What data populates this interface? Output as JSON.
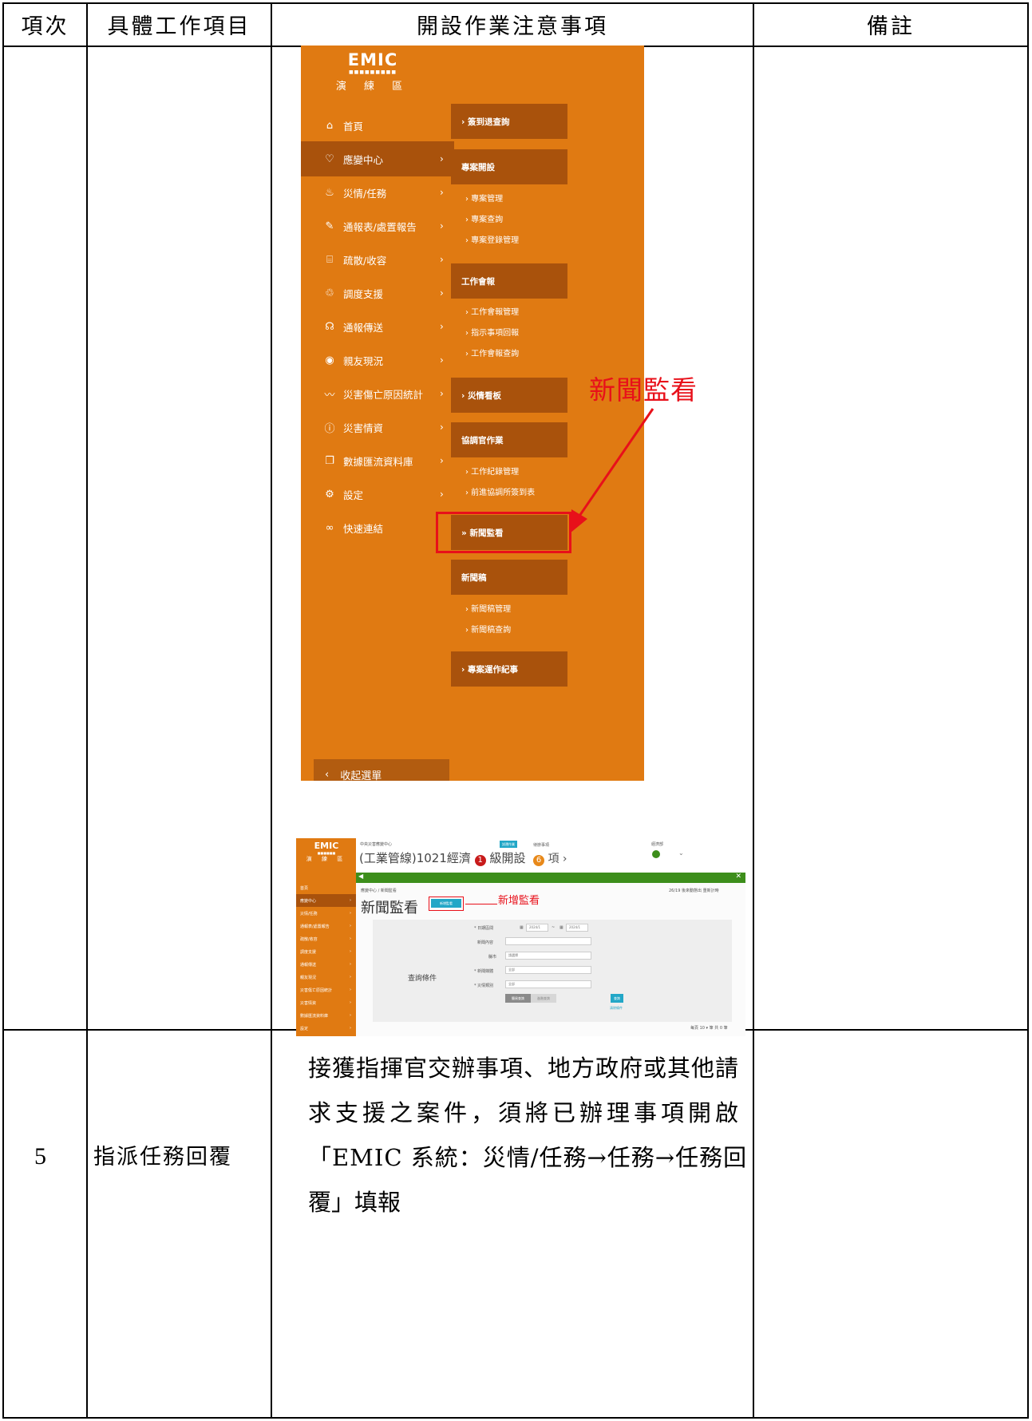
{
  "table": {
    "headers": [
      "項次",
      "具體工作項目",
      "開設作業注意事項",
      "備註"
    ],
    "row5": {
      "number": "5",
      "item": "指派任務回覆",
      "note_lines": [
        "接獲指揮官交辦事項、地方政府或其他請",
        "求支援之案件，須將已辦理事項開啟",
        "「EMIC 系統：災情/任務→任務→任務回",
        "覆」填報"
      ]
    }
  },
  "screenshot1": {
    "logo": {
      "brand": "EMIC",
      "tiny": "■■■■■■■■■",
      "sub": "演 練 區"
    },
    "menu": [
      {
        "icon": "home-icon",
        "glyph": "⌂",
        "label": "首頁",
        "chevron": ""
      },
      {
        "icon": "shield-icon",
        "glyph": "♡",
        "label": "應變中心",
        "chevron": "›",
        "active": true
      },
      {
        "icon": "disaster-icon",
        "glyph": "♨",
        "label": "災情/任務",
        "chevron": "›"
      },
      {
        "icon": "edit-icon",
        "glyph": "✎",
        "label": "通報表/處置報告",
        "chevron": "›"
      },
      {
        "icon": "shelter-icon",
        "glyph": "⌸",
        "label": "疏散/收容",
        "chevron": "›"
      },
      {
        "icon": "support-icon",
        "glyph": "♲",
        "label": "調度支援",
        "chevron": "›"
      },
      {
        "icon": "transmit-icon",
        "glyph": "☊",
        "label": "通報傳送",
        "chevron": "›"
      },
      {
        "icon": "eye-icon",
        "glyph": "◉",
        "label": "親友現況",
        "chevron": "›"
      },
      {
        "icon": "trend-icon",
        "glyph": "〰",
        "label": "災害傷亡原因統計",
        "chevron": "›"
      },
      {
        "icon": "info-icon",
        "glyph": "ⓘ",
        "label": "災害情資",
        "chevron": "›"
      },
      {
        "icon": "database-icon",
        "glyph": "❐",
        "label": "數據匯流資料庫",
        "chevron": "›"
      },
      {
        "icon": "gear-icon",
        "glyph": "⚙",
        "label": "設定",
        "chevron": "›"
      },
      {
        "icon": "link-icon",
        "glyph": "∞",
        "label": "快速連結",
        "chevron": ""
      }
    ],
    "collapse_label": "收起選單",
    "submenu": {
      "checkin": "› 簽到退查詢",
      "project_settings": "專案開設",
      "project_links": [
        "› 專案管理",
        "› 專案查詢",
        "› 專案登錄管理"
      ],
      "meeting": "工作會報",
      "meeting_links": [
        "› 工作會報管理",
        "› 指示事項回報",
        "› 工作會報查詢"
      ],
      "board": "› 災情看板",
      "coordinator": "協調官作業",
      "coordinator_links": [
        "› 工作紀錄管理",
        "› 前進協調所簽到表"
      ],
      "news_monitor": "» 新聞監看",
      "press": "新聞稿",
      "press_links": [
        "› 新聞稿管理",
        "› 新聞稿查詢"
      ],
      "chronicle": "› 專案運作紀事"
    },
    "callout": "新聞監看"
  },
  "screenshot2": {
    "logo": {
      "brand": "EMIC",
      "tiny": "■■■■■■",
      "sub": "演 練 區"
    },
    "side_items": [
      "首頁",
      "應變中心",
      "災情/任務",
      "通報表/處置報告",
      "疏散/收容",
      "調度支援",
      "通報傳送",
      "親友現況",
      "災害傷亡原因統計",
      "災害情資",
      "數據匯流資料庫",
      "設定"
    ],
    "top": {
      "org": "中央災害應變中心",
      "project": "(工業管線)1021經濟",
      "level_num": "1",
      "level_text": "級開設",
      "badge": "試運作業",
      "pending_label": "待辦事項",
      "pending_num": "6",
      "pending_text": "項 ›",
      "user": "經濟部"
    },
    "breadcrumb": "應變中心 / 新聞監看",
    "right_info": "26/19 後來動態出 重新計時",
    "title": "新聞監看",
    "add_button": "新增監看",
    "callout": "新增監看",
    "form": {
      "section_label": "查詢條件",
      "date_label": "* 日期區間",
      "date_from": "2024/1",
      "date_to": "2024/1",
      "keyword_label": "新聞內容",
      "county_label": "縣市",
      "county_value": "請選擇",
      "channel_label": "* 新聞媒體",
      "channel_value": "全部",
      "category_label": "* 災情類別",
      "category_value": "全部",
      "btn_simple": "簡易查詢",
      "btn_advanced": "進階查詢",
      "btn_search": "查詢",
      "clear_link": "清除條件"
    },
    "pager": "每頁 10 ▾  筆 共 0 筆"
  }
}
